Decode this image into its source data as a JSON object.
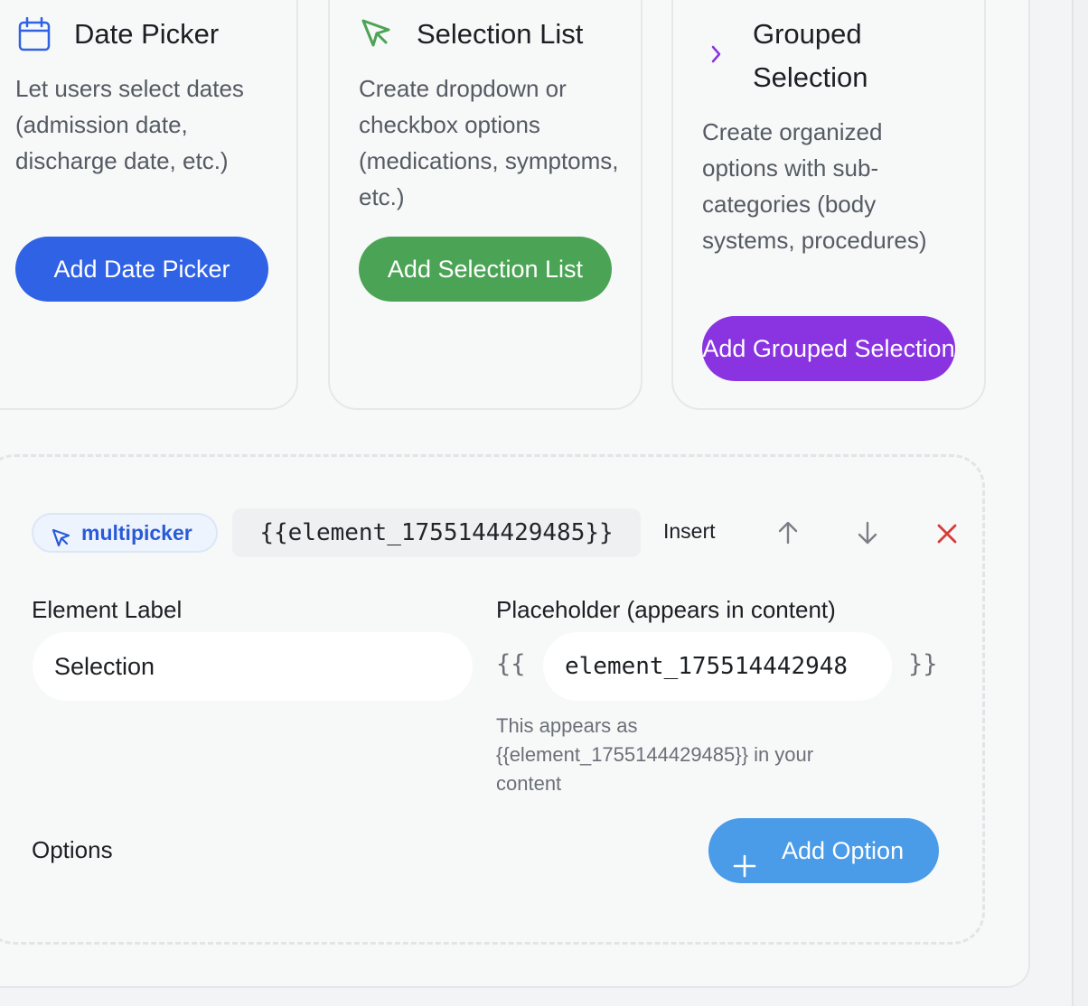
{
  "cards": [
    {
      "icon": "calendar-icon",
      "title": "Date Picker",
      "description": "Let users select dates (admission date, discharge date, etc.)",
      "button_label": "Add Date Picker",
      "color": "#2f62e4"
    },
    {
      "icon": "cursor-arrow-icon",
      "title": "Selection List",
      "description": "Create dropdown or checkbox options (medications, symptoms, etc.)",
      "button_label": "Add Selection List",
      "color": "#4ba455"
    },
    {
      "icon": "chevron-right-icon",
      "title": "Grouped Selection",
      "description": "Create organized options with sub-categories (body systems, procedures)",
      "button_label": "Add Grouped Selection",
      "color": "#8a33e1"
    }
  ],
  "element": {
    "type_chip": "multipicker",
    "placeholder_code": "{{element_1755144429485}}",
    "insert_label": "Insert",
    "actions": [
      "arrow-up-icon",
      "arrow-down-icon",
      "close-icon"
    ],
    "label_field": {
      "label": "Element Label",
      "value": "Selection"
    },
    "placeholder_field": {
      "label": "Placeholder (appears in content)",
      "open_brace": "{{",
      "close_brace": "}}",
      "value": "element_175514442948",
      "hint": "This appears as {{element_1755144429485}} in your content"
    },
    "options_label": "Options",
    "add_option_label": "Add Option"
  },
  "colors": {
    "chip_text": "#2a5bd7",
    "delete": "#d63b3b",
    "add_option": "#4a9be8"
  }
}
